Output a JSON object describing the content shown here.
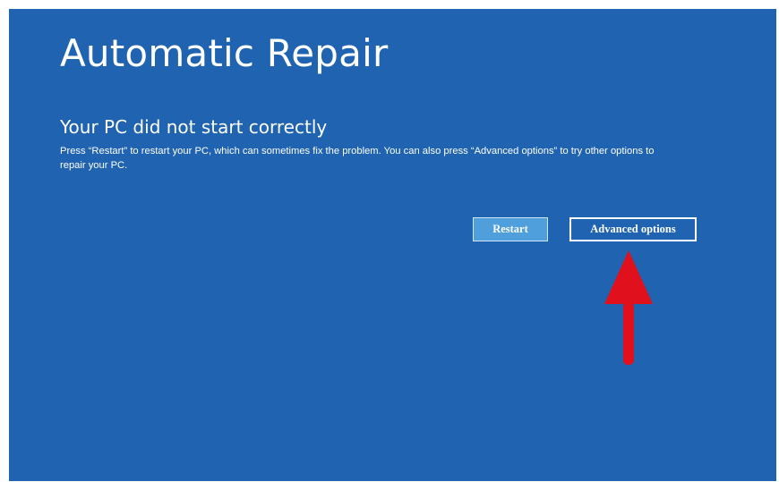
{
  "screen": {
    "title": "Automatic Repair",
    "subtitle": "Your PC did not start correctly",
    "message": "Press “Restart” to restart your PC, which can sometimes fix the problem. You can also press “Advanced options” to try other options to repair your PC.",
    "background_color": "#1f63b1"
  },
  "buttons": {
    "restart_label": "Restart",
    "advanced_options_label": "Advanced options",
    "restart_color": "#4e9fdb"
  },
  "annotation": {
    "icon": "red-arrow-up-icon",
    "color": "#e0101c"
  }
}
